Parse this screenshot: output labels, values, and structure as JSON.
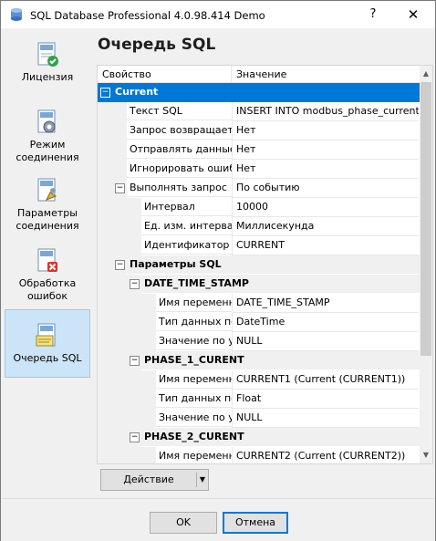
{
  "window": {
    "title": "SQL Database Professional 4.0.98.414 Demo",
    "help": "?",
    "close": "✕"
  },
  "sidebar": {
    "items": [
      {
        "label": "Лицензия",
        "icon": "license-check-icon"
      },
      {
        "label": "Режим соединения",
        "icon": "connection-mode-gear-icon"
      },
      {
        "label": "Параметры соединения",
        "icon": "connection-params-icon"
      },
      {
        "label": "Обработка ошибок",
        "icon": "error-handling-icon"
      },
      {
        "label": "Очередь SQL",
        "icon": "sql-queue-icon",
        "selected": true
      }
    ]
  },
  "page": {
    "title": "Очередь SQL"
  },
  "grid": {
    "header": {
      "property": "Свойство",
      "value": "Значение"
    },
    "rows": [
      {
        "level": 0,
        "cat": true,
        "toggle": "−",
        "name": "Current",
        "value": "",
        "selected": true
      },
      {
        "level": 1,
        "name": "Текст SQL",
        "value": "INSERT INTO modbus_phase_current..."
      },
      {
        "level": 1,
        "name": "Запрос возвращает з...",
        "value": "Нет"
      },
      {
        "level": 1,
        "name": "Отправлять данные за...",
        "value": "Нет"
      },
      {
        "level": 1,
        "name": "Игнорировать ошибки ...",
        "value": "Нет"
      },
      {
        "level": 1,
        "toggle": "−",
        "name": "Выполнять запрос",
        "value": "По событию"
      },
      {
        "level": 2,
        "name": "Интервал",
        "value": "10000"
      },
      {
        "level": 2,
        "name": "Ед. изм. интервала",
        "value": "Миллисекунда"
      },
      {
        "level": 2,
        "name": "Идентификатор со...",
        "value": "CURRENT"
      },
      {
        "level": 1,
        "cat": true,
        "toggle": "−",
        "name": "Параметры SQL",
        "value": ""
      },
      {
        "level": 2,
        "cat": true,
        "toggle": "−",
        "name": "DATE_TIME_STAMP",
        "value": ""
      },
      {
        "level": 3,
        "name": "Имя переменно...",
        "value": "DATE_TIME_STAMP"
      },
      {
        "level": 3,
        "name": "Тип данных пол...",
        "value": "DateTime"
      },
      {
        "level": 3,
        "name": "Значение по ум...",
        "value": "NULL"
      },
      {
        "level": 2,
        "cat": true,
        "toggle": "−",
        "name": "PHASE_1_CURENT",
        "value": ""
      },
      {
        "level": 3,
        "name": "Имя переменно...",
        "value": "CURRENT1 (Current (CURRENT1))"
      },
      {
        "level": 3,
        "name": "Тип данных пол...",
        "value": "Float"
      },
      {
        "level": 3,
        "name": "Значение по ум...",
        "value": "NULL"
      },
      {
        "level": 2,
        "cat": true,
        "toggle": "−",
        "name": "PHASE_2_CURENT",
        "value": ""
      },
      {
        "level": 3,
        "name": "Имя переменно...",
        "value": "CURRENT2 (Current (CURRENT2))"
      }
    ]
  },
  "actions": {
    "action_label": "Действие"
  },
  "footer": {
    "ok": "OK",
    "cancel": "Отмена"
  },
  "colors": {
    "accent": "#0078d7",
    "selection_bg": "#cce4f7"
  }
}
